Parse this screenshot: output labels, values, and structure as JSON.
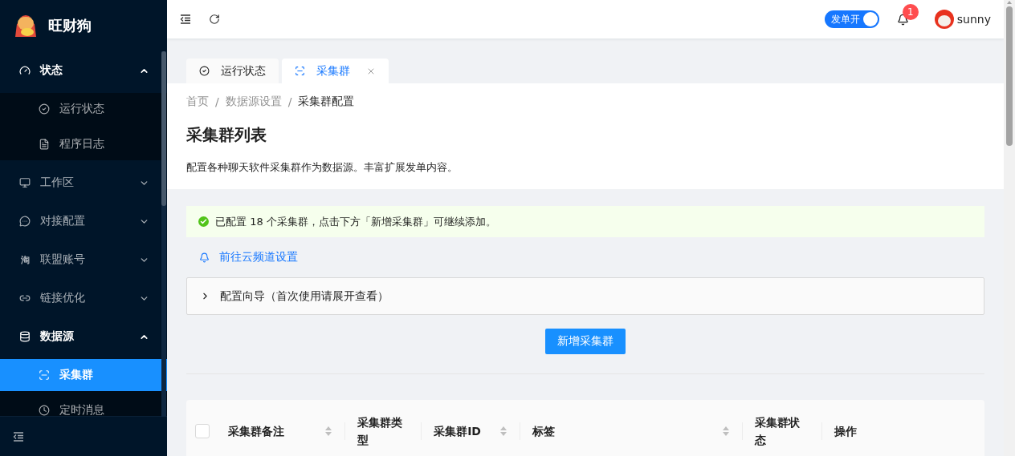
{
  "sidebar": {
    "app_name": "旺财狗",
    "menu": [
      {
        "label": "状态",
        "expanded": true,
        "children": [
          {
            "label": "运行状态",
            "selected": false
          },
          {
            "label": "程序日志",
            "selected": false
          }
        ]
      },
      {
        "label": "工作区",
        "expanded": false
      },
      {
        "label": "对接配置",
        "expanded": false
      },
      {
        "label": "联盟账号",
        "expanded": false,
        "icon_text": "淘"
      },
      {
        "label": "链接优化",
        "expanded": false
      },
      {
        "label": "数据源",
        "expanded": true,
        "children": [
          {
            "label": "采集群",
            "selected": true
          },
          {
            "label": "定时消息",
            "selected": false
          }
        ]
      }
    ]
  },
  "header": {
    "order_switch": {
      "label": "发单开",
      "on": true
    },
    "notification_count": "1",
    "user": "sunny"
  },
  "tabs": [
    {
      "label": "运行状态",
      "selected": false,
      "closable": false
    },
    {
      "label": "采集群",
      "selected": true,
      "closable": true
    }
  ],
  "breadcrumb": [
    "首页",
    "数据源设置",
    "采集群配置"
  ],
  "breadcrumb_separator": "/",
  "page": {
    "title": "采集群列表",
    "description": "配置各种聊天软件采集群作为数据源。丰富扩展发单内容。"
  },
  "alert": {
    "text": "已配置 18 个采集群，点击下方「新增采集群」可继续添加。"
  },
  "link": "前往云频道设置",
  "guide": {
    "label": "配置向导（首次使用请展开查看）",
    "expanded": false
  },
  "add_button": "新增采集群",
  "table": {
    "select_all": {
      "checked": false
    },
    "columns": [
      {
        "title": "采集群备注",
        "sortable": true
      },
      {
        "title": "采集群类型",
        "sortable": false
      },
      {
        "title": "采集群ID",
        "sortable": true
      },
      {
        "title": "标签",
        "sortable": true
      },
      {
        "title": "采集群状态",
        "sortable": false
      },
      {
        "title": "操作",
        "sortable": false
      }
    ]
  }
}
